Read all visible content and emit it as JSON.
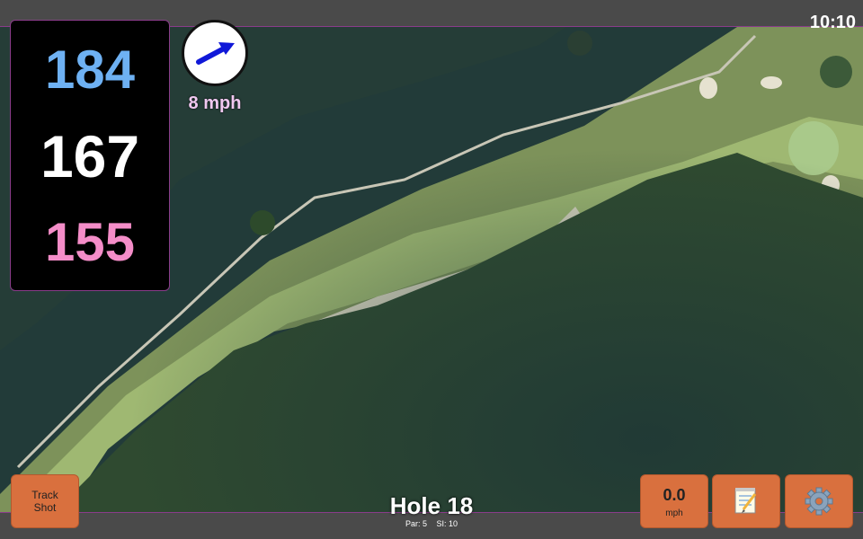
{
  "clock": "10:10",
  "distances": {
    "back": "184",
    "center": "167",
    "front": "155"
  },
  "wind": {
    "speed_label": "8 mph",
    "icon": "wind-arrow-icon",
    "direction_deg": 60
  },
  "track_shot": {
    "line1": "Track",
    "line2": "Shot"
  },
  "hole": {
    "title": "Hole 18",
    "par_label": "Par: 5",
    "si_label": "SI: 10"
  },
  "speed_button": {
    "value": "0.0",
    "unit": "mph"
  },
  "icons": {
    "notes": "notepad-icon",
    "settings": "gear-icon"
  },
  "colors": {
    "back": "#6eb1f3",
    "center": "#ffffff",
    "front": "#f48dc8",
    "accent": "#d9703e",
    "border": "#8a3c8a"
  }
}
